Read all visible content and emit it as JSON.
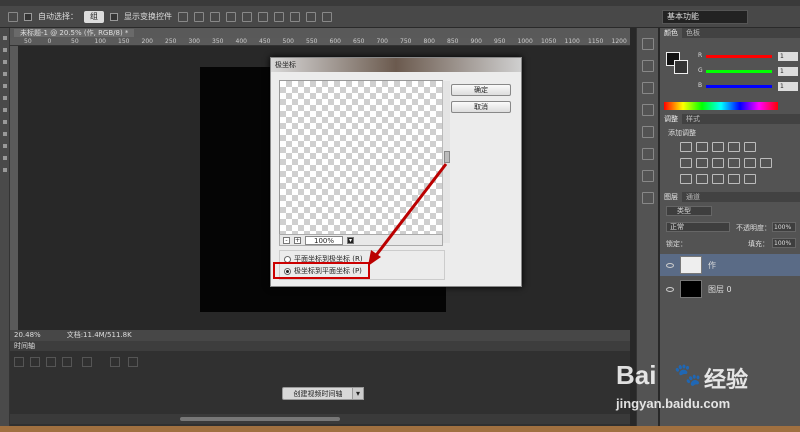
{
  "options_bar": {
    "auto_select_label": "自动选择：",
    "auto_select_value": "组",
    "show_transform_label": "显示变换控件",
    "workspace": "基本功能"
  },
  "document": {
    "tab_title": "未标题-1 @ 20.5% (作, RGB/8) *",
    "ruler_ticks": [
      "50",
      "0",
      "50",
      "100",
      "150",
      "200",
      "250",
      "300",
      "350",
      "400",
      "450",
      "500",
      "550",
      "600",
      "650",
      "700",
      "750",
      "800",
      "850",
      "900",
      "950",
      "1000",
      "1050",
      "1100",
      "1150",
      "1200"
    ],
    "zoom": "20.48%",
    "doc_info": "文档:11.4M/511.8K"
  },
  "timeline": {
    "title": "时间轴",
    "create_button": "创建视频时间轴"
  },
  "dialog": {
    "title": "极坐标",
    "ok": "确定",
    "cancel": "取消",
    "zoom_value": "100%",
    "minus": "-",
    "plus": "+",
    "option1": "平面坐标到极坐标 (R)",
    "option2": "极坐标到平面坐标 (P)"
  },
  "color_panel": {
    "tabs": [
      "颜色",
      "色板"
    ],
    "channels": [
      {
        "label": "R",
        "value": "1",
        "color": "#ff0000"
      },
      {
        "label": "G",
        "value": "1",
        "color": "#00ff00"
      },
      {
        "label": "B",
        "value": "1",
        "color": "#0000ff"
      }
    ]
  },
  "adjust_panel": {
    "tabs": [
      "调整",
      "样式"
    ],
    "add_label": "添加调整"
  },
  "layers_panel": {
    "tabs": [
      "图层",
      "通道"
    ],
    "filter": "类型",
    "blend_mode": "正常",
    "opacity_label": "不透明度：",
    "opacity_value": "100%",
    "lock_label": "锁定：",
    "fill_label": "填充：",
    "fill_value": "100%",
    "layers": [
      {
        "name": "作",
        "selected": true
      },
      {
        "name": "图层 0",
        "selected": false
      }
    ]
  },
  "watermark": {
    "brand": "Bai",
    "brand2": "经验",
    "url": "jingyan.baidu.com"
  }
}
